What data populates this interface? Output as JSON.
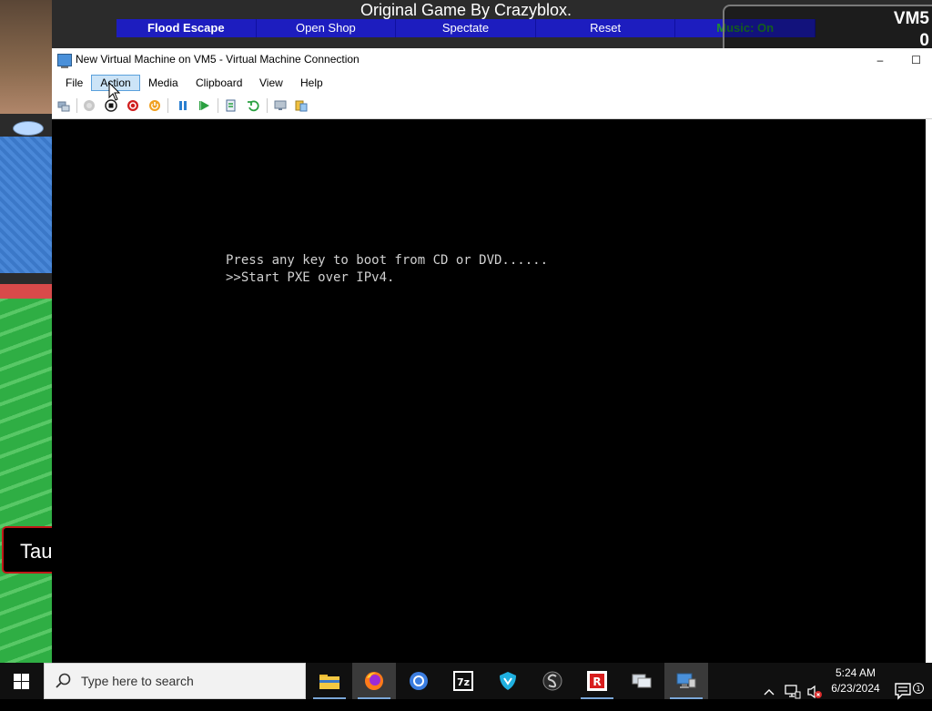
{
  "game": {
    "title": "Original Game By Crazyblox.",
    "menu": [
      "Flood Escape",
      "Open Shop",
      "Spectate",
      "Reset",
      "Music: On"
    ],
    "badge_name": "VM5",
    "badge_count": "0",
    "side_label": "Tau"
  },
  "window": {
    "title": "New Virtual Machine on VM5 - Virtual Machine Connection",
    "minimize": "–",
    "maximize": "☐"
  },
  "menus": [
    "File",
    "Action",
    "Media",
    "Clipboard",
    "View",
    "Help"
  ],
  "active_menu": "Action",
  "console": {
    "line1": "Press any key to boot from CD or DVD......",
    "line2": ">>Start PXE over IPv4."
  },
  "taskbar": {
    "search_placeholder": "Type here to search",
    "time": "5:24 AM",
    "date": "6/23/2024"
  },
  "colors": {
    "game_menu_bg": "#1d1dbf",
    "menu_active": "#cce4f7",
    "taskbar": "#101010"
  }
}
